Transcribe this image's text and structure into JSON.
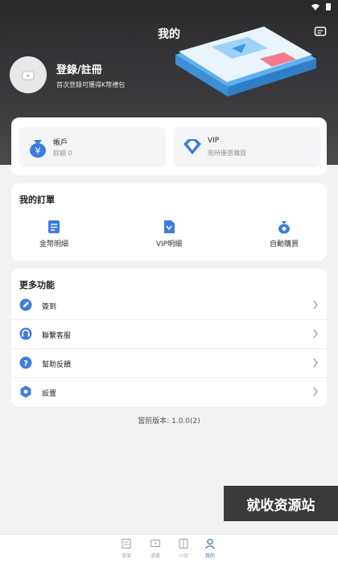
{
  "header": {
    "title": "我的",
    "message_icon": "message-icon"
  },
  "profile": {
    "login_title": "登錄/註冊",
    "login_subtitle": "首次登錄可獲得K幣禮包",
    "avatar_icon": "avatar-placeholder-icon"
  },
  "accounts": {
    "account": {
      "label": "帳戶",
      "sub": "餘額 0",
      "icon": "money-bag-icon"
    },
    "vip": {
      "label": "VIP",
      "sub": "限時優惠購買",
      "icon": "diamond-icon"
    }
  },
  "orders": {
    "title": "我的訂單",
    "items": [
      {
        "label": "金幣明細",
        "icon": "coin-detail-icon"
      },
      {
        "label": "VIP明細",
        "icon": "vip-detail-icon"
      },
      {
        "label": "自動購買",
        "icon": "auto-buy-icon"
      }
    ]
  },
  "more": {
    "title": "更多功能",
    "items": [
      {
        "label": "簽到",
        "icon": "sign-in-icon"
      },
      {
        "label": "聯繫客服",
        "icon": "customer-service-icon"
      },
      {
        "label": "幫助反饋",
        "icon": "help-icon"
      },
      {
        "label": "設置",
        "icon": "settings-icon"
      }
    ]
  },
  "version_text": "當前版本: 1.0.0(2)",
  "watermark_text": "就收资源站",
  "bottom_nav": [
    {
      "label": "書架",
      "icon": "bookshelf-icon",
      "active": false
    },
    {
      "label": "漫畫",
      "icon": "comic-icon",
      "active": false
    },
    {
      "label": "小說",
      "icon": "novel-icon",
      "active": false
    },
    {
      "label": "我的",
      "icon": "profile-icon",
      "active": true
    }
  ],
  "colors": {
    "accent": "#3b7de0",
    "header_dark": "#2b2b2e",
    "nav_active": "#4a6fb0"
  }
}
